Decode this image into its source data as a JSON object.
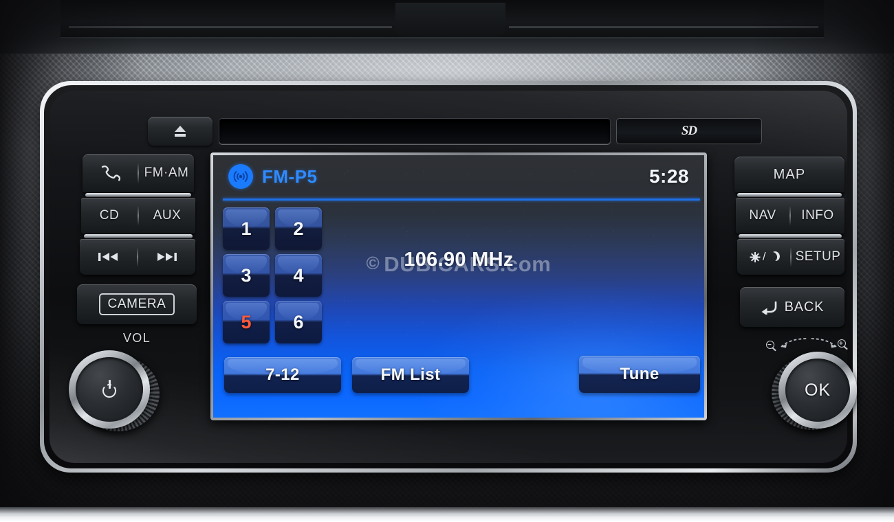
{
  "device": {
    "name": "car-infotainment-head-unit",
    "accent_blue": "#1a7bff",
    "active_preset_color": "#ff5a3c",
    "screen_text_color": "#f6f8fb"
  },
  "top_row": {
    "eject_icon": "eject-icon",
    "cd_slot_label": "",
    "sd_slot_label": "SD"
  },
  "left_buttons": {
    "phone_icon": "phone-handset-icon",
    "fm_am": "FM·AM",
    "cd": "CD",
    "aux": "AUX",
    "prev_icon": "previous-track-icon",
    "next_icon": "next-track-icon",
    "camera": "CAMERA",
    "vol_label": "VOL",
    "power_icon": "power-icon"
  },
  "right_buttons": {
    "map": "MAP",
    "nav": "NAV",
    "info": "INFO",
    "day_night_icon": "sun-moon-icon",
    "setup": "SETUP",
    "back": "BACK",
    "back_icon": "back-arrow-icon",
    "ok": "OK",
    "zoom_out_icon": "magnifier-minus-icon",
    "zoom_in_icon": "magnifier-plus-icon"
  },
  "screen": {
    "source_icon": "radio-waves-icon",
    "source_label": "FM-P5",
    "clock": "5:28",
    "frequency": "106.90 MHz",
    "watermark": "DUBICARS.com",
    "watermark_copyright": "©",
    "presets": [
      {
        "label": "1",
        "active": false
      },
      {
        "label": "2",
        "active": false
      },
      {
        "label": "3",
        "active": false
      },
      {
        "label": "4",
        "active": false
      },
      {
        "label": "5",
        "active": true
      },
      {
        "label": "6",
        "active": false
      }
    ],
    "soft_buttons": {
      "page": "7-12",
      "list": "FM List",
      "tune": "Tune"
    }
  }
}
